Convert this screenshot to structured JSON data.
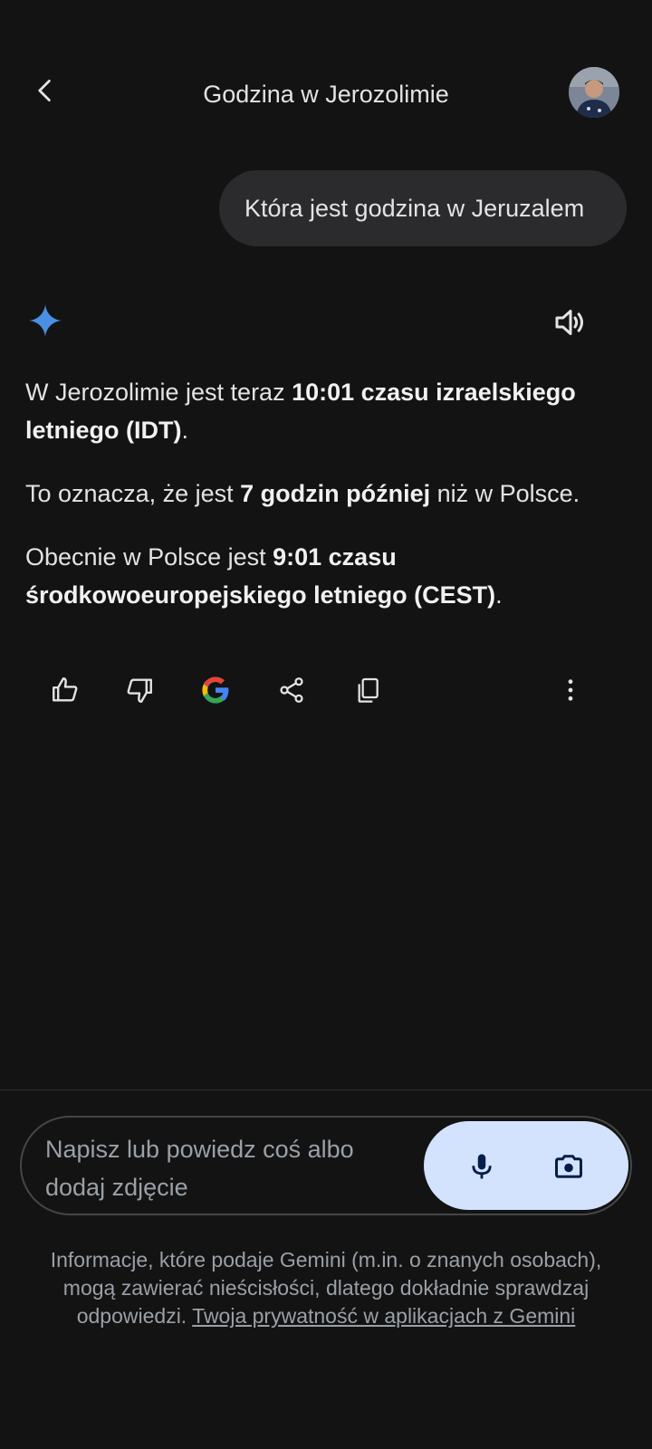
{
  "header": {
    "title": "Godzina w Jerozolimie",
    "back_icon": "arrow-back-icon",
    "avatar": "user-avatar"
  },
  "user_message": "Która jest godzina w Jeruzalem",
  "response": {
    "p1": {
      "a": "W Jerozolimie jest teraz ",
      "b": "10:01 czasu izraelskiego letniego (IDT)",
      "c": "."
    },
    "p2": {
      "a": "To oznacza, że jest ",
      "b": "7 godzin później",
      "c": " niż w Polsce."
    },
    "p3": {
      "a": "Obecnie w Polsce jest ",
      "b": "9:01 czasu środkowoeuropejskiego letniego (CEST)",
      "c": "."
    }
  },
  "actions": [
    "thumbs-up-icon",
    "thumbs-down-icon",
    "google-icon",
    "share-icon",
    "copy-icon",
    "more-vert-icon"
  ],
  "input": {
    "placeholder": "Napisz lub powiedz coś albo dodaj zdjęcie"
  },
  "disclaimer": {
    "text": "Informacje, które podaje Gemini (m.in. o znanych osobach), mogą zawierać nieścisłości, dlatego dokładnie sprawdzaj odpowiedzi. ",
    "link": "Twoja prywatność w aplikacjach z Gemini"
  },
  "colors": {
    "background": "#131314",
    "bubble": "#2b2b2d",
    "sparkle": "#4a90e2",
    "pill": "#d3e3fd",
    "pill_icon": "#041e49"
  }
}
